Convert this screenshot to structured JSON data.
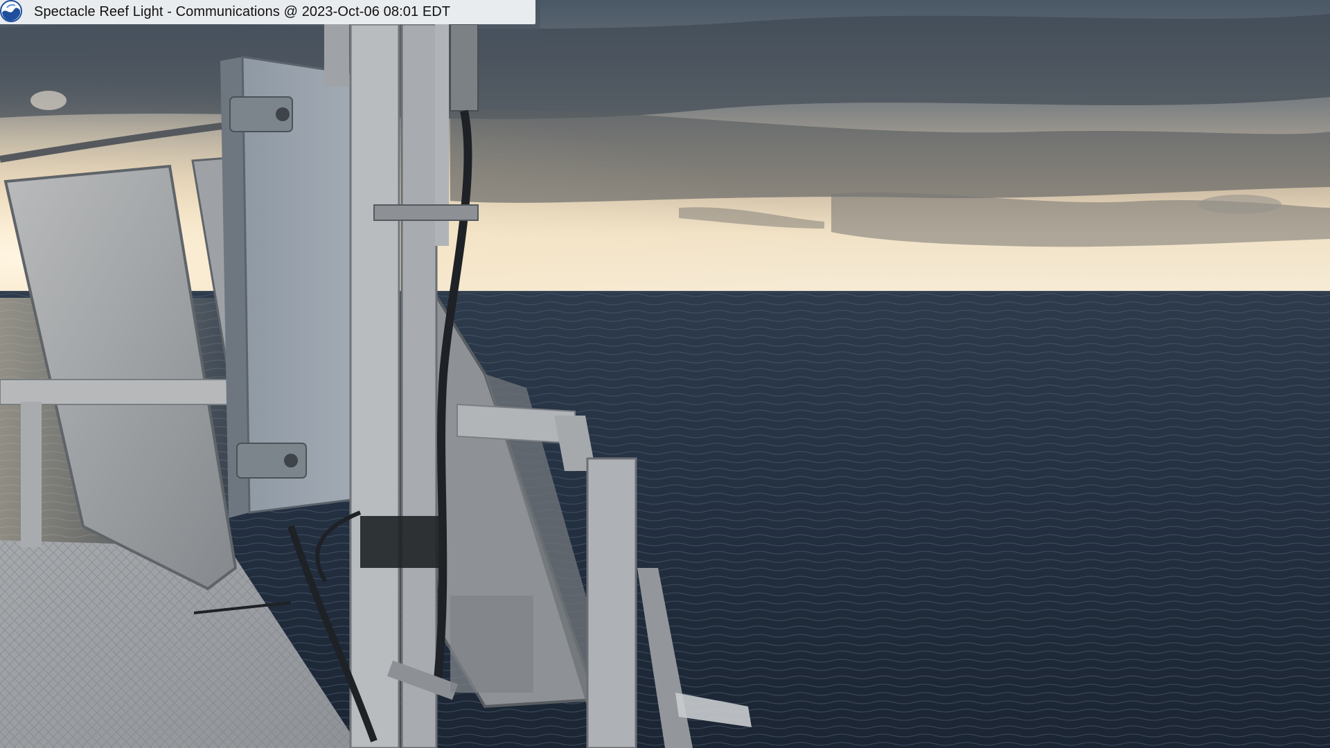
{
  "camera": {
    "caption": "Spectacle Reef Light - Communications @ 2023-Oct-06 08:01 EDT",
    "logo_icon": "noaa-logo-icon"
  },
  "scene": {
    "description_icons": [
      "sky",
      "clouds",
      "horizon",
      "lake-water",
      "solar-panel",
      "equipment-enclosure",
      "antenna-mast",
      "railing",
      "deck"
    ]
  },
  "colors": {
    "caption_background": "#f5f7fa",
    "caption_text": "#111111",
    "noaa_blue": "#1f4f9c"
  }
}
